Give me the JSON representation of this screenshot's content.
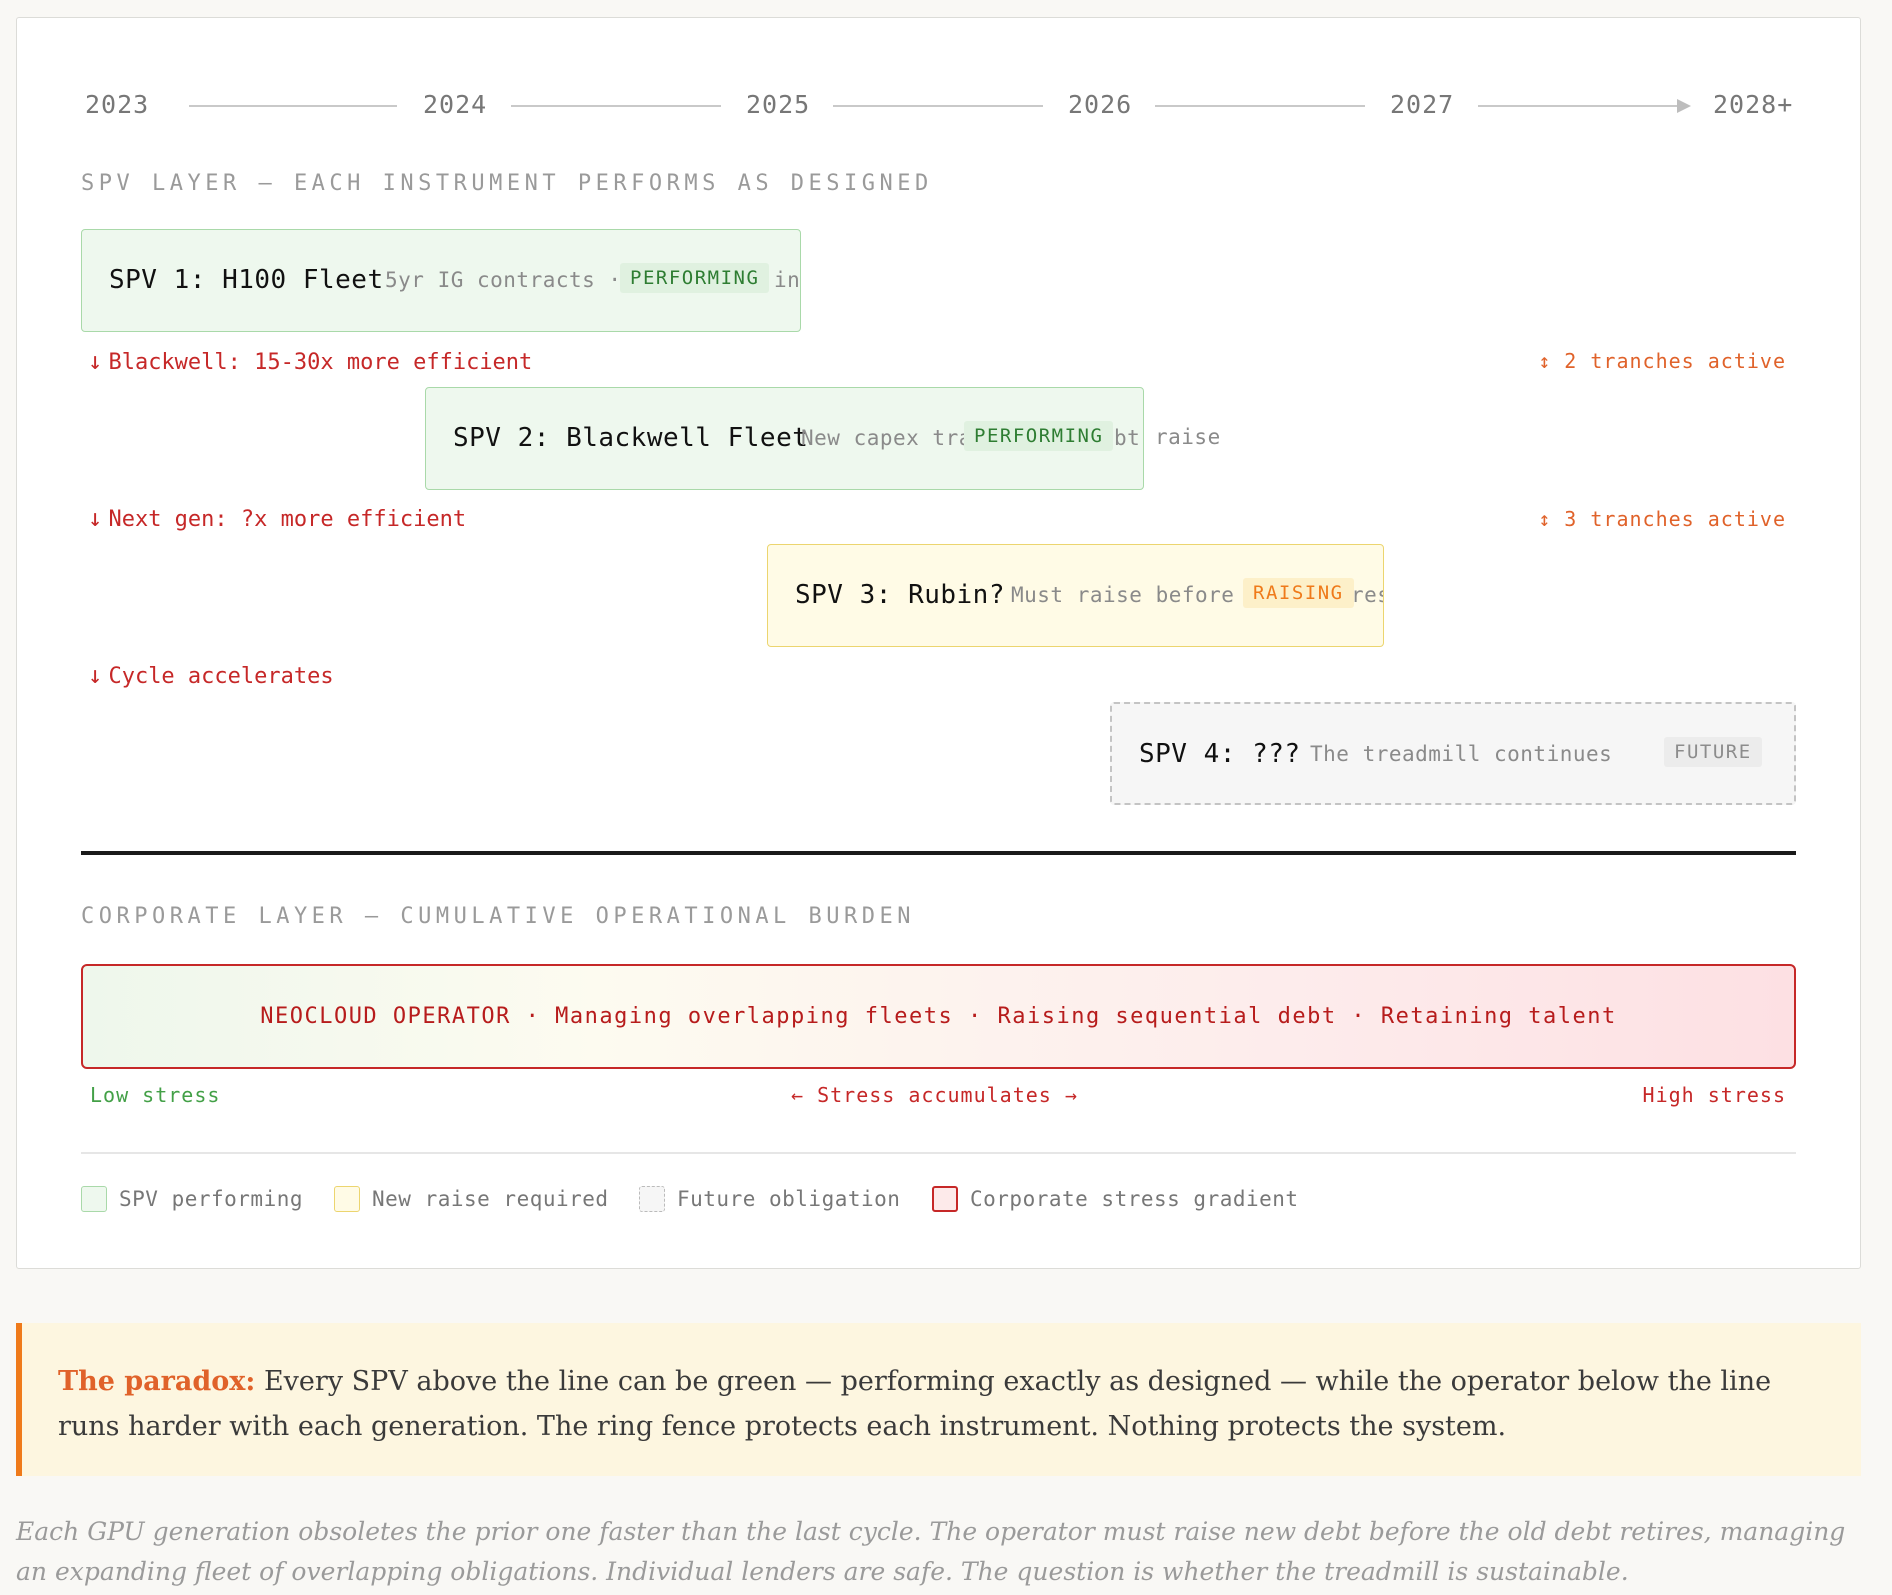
{
  "timeline": {
    "years": [
      "2023",
      "2024",
      "2025",
      "2026",
      "2027",
      "2028+"
    ]
  },
  "spv_layer": {
    "label": "SPV LAYER — EACH INSTRUMENT PERFORMS AS DESIGNED",
    "spvs": [
      {
        "title": "SPV 1: H100 Fleet",
        "desc": "5yr IG contracts · P",
        "desc_tail": "ing",
        "badge": "PERFORMING",
        "status": "performing"
      },
      {
        "title": "SPV 2: Blackwell Fleet",
        "desc": "New capex tra",
        "desc_tail": "bt raise",
        "badge": "PERFORMING",
        "status": "performing"
      },
      {
        "title": "SPV 3: Rubin?",
        "desc": "Must raise before S",
        "desc_tail": "res",
        "badge": "RAISING",
        "status": "raising"
      },
      {
        "title": "SPV 4: ???",
        "desc": "The treadmill continues",
        "desc_tail": "",
        "badge": "FUTURE",
        "status": "future"
      }
    ],
    "notes": [
      {
        "text": "Blackwell: 15-30x more efficient",
        "tranche": "↕ 2 tranches active"
      },
      {
        "text": "Next gen: ?x more efficient",
        "tranche": "↕ 3 tranches active"
      },
      {
        "text": "Cycle accelerates",
        "tranche": ""
      }
    ],
    "arrow_glyph": "↓"
  },
  "corporate_layer": {
    "label": "CORPORATE LAYER — CUMULATIVE OPERATIONAL BURDEN",
    "bar_text": "NEOCLOUD OPERATOR · Managing overlapping fleets · Raising sequential debt · Retaining talent",
    "low": "Low stress",
    "mid": "← Stress accumulates →",
    "high": "High stress"
  },
  "legend": [
    {
      "label": "SPV performing"
    },
    {
      "label": "New raise required"
    },
    {
      "label": "Future obligation"
    },
    {
      "label": "Corporate stress gradient"
    }
  ],
  "callout": {
    "lead": "The paradox:",
    "body": " Every SPV above the line can be green — performing exactly as designed — while the operator below the line runs harder with each generation. The ring fence protects each instrument. Nothing protects the system."
  },
  "caption": "Each GPU generation obsoletes the prior one faster than the last cycle. The operator must raise new debt before the old debt retires, managing an expanding fleet of overlapping obligations. Individual lenders are safe. The question is whether the treadmill is sustainable.",
  "colors": {
    "performing": "#2e7d32",
    "raising": "#ef7a1a",
    "stress": "#c62828",
    "accent": "#e0622a"
  }
}
